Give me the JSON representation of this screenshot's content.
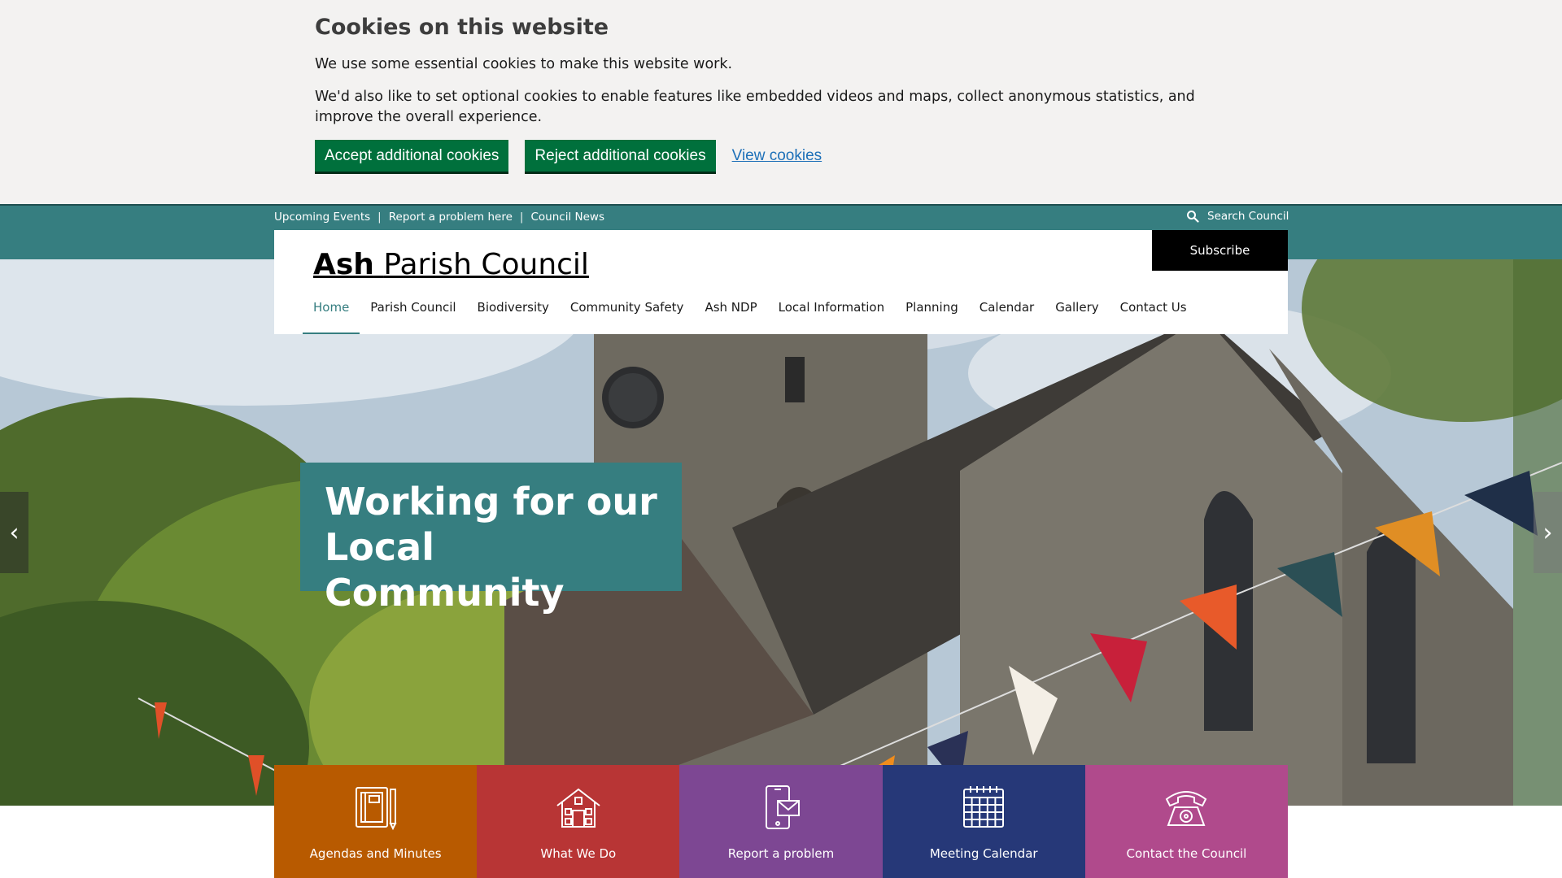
{
  "cookie_banner": {
    "title": "Cookies on this website",
    "line1": "We use some essential cookies to make this website work.",
    "line2": "We'd also like to set optional cookies to enable features like embedded videos and maps, collect anonymous statistics, and improve the overall experience.",
    "accept_label": "Accept additional cookies",
    "reject_label": "Reject additional cookies",
    "view_label": "View cookies",
    "button_color": "#00703c",
    "link_color": "#1d70b8"
  },
  "utility_bar": {
    "links": [
      "Upcoming Events",
      "Report a problem here",
      "Council News"
    ],
    "separator": "|",
    "search_label": "Search Council",
    "color": "#367e80"
  },
  "header": {
    "brand_bold": "Ash",
    "brand_rest": "Parish Council",
    "subscribe_label": "Subscribe",
    "nav": [
      "Home",
      "Parish Council",
      "Biodiversity",
      "Community Safety",
      "Ash NDP",
      "Local Information",
      "Planning",
      "Calendar",
      "Gallery",
      "Contact Us"
    ],
    "active_nav": "Home"
  },
  "hero": {
    "title_line1": "Working for our",
    "title_line2": "Local Community",
    "prev_icon": "chevron-left-icon",
    "next_icon": "chevron-right-icon"
  },
  "tiles": [
    {
      "label": "Agendas and Minutes",
      "color": "#b85a00",
      "icon": "notebook-icon"
    },
    {
      "label": "What We Do",
      "color": "#b83535",
      "icon": "house-icon"
    },
    {
      "label": "Report a problem",
      "color": "#7d4793",
      "icon": "mobile-mail-icon"
    },
    {
      "label": "Meeting Calendar",
      "color": "#263878",
      "icon": "calendar-icon"
    },
    {
      "label": "Contact the Council",
      "color": "#b04a8c",
      "icon": "telephone-icon"
    }
  ]
}
